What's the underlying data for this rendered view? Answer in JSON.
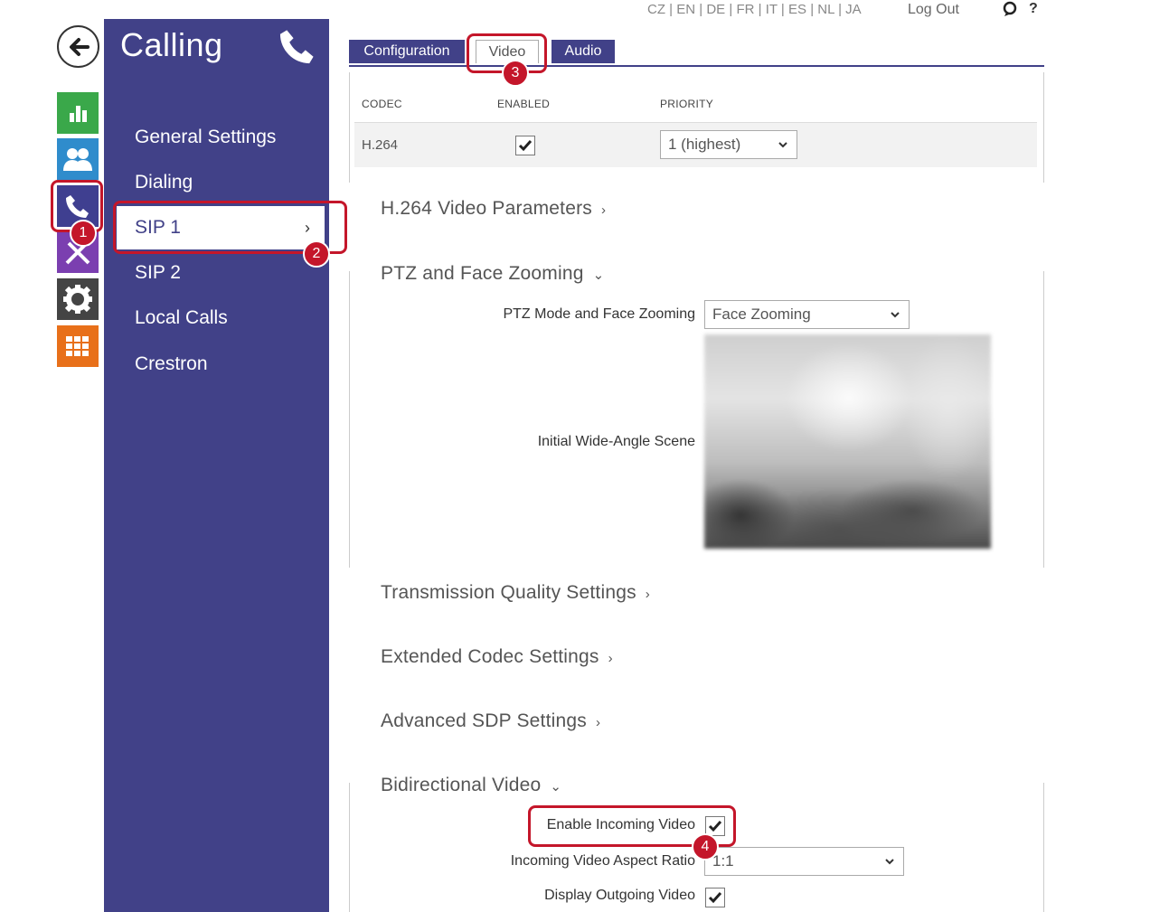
{
  "rail": {
    "back": "back-arrow-icon",
    "items": [
      "status-icon",
      "directory-icon",
      "calling-icon",
      "services-icon",
      "hardware-icon",
      "system-icon"
    ]
  },
  "sidebar": {
    "title": "Calling",
    "items": [
      {
        "label": "General Settings"
      },
      {
        "label": "Dialing"
      },
      {
        "label": "SIP 1",
        "chevron": "›"
      },
      {
        "label": "SIP 2"
      },
      {
        "label": "Local Calls"
      },
      {
        "label": "Crestron"
      }
    ]
  },
  "topbar": {
    "languages": [
      "CZ",
      "EN",
      "DE",
      "FR",
      "IT",
      "ES",
      "NL",
      "JA"
    ],
    "separator": "|",
    "logout": "Log Out",
    "help": "?"
  },
  "tabs": [
    {
      "label": "Configuration"
    },
    {
      "label": "Video",
      "active": true
    },
    {
      "label": "Audio"
    }
  ],
  "codec_table": {
    "headers": [
      "CODEC",
      "ENABLED",
      "PRIORITY"
    ],
    "rows": [
      {
        "codec": "H.264",
        "enabled": true,
        "priority": "1 (highest)"
      }
    ]
  },
  "sections": {
    "h264": {
      "title": "H.264 Video Parameters",
      "chevron": "›"
    },
    "ptz": {
      "title": "PTZ and Face Zooming",
      "chevron": "⌄",
      "mode_label": "PTZ Mode and Face Zooming",
      "mode_value": "Face Zooming",
      "scene_label": "Initial Wide-Angle Scene"
    },
    "transmission": {
      "title": "Transmission Quality Settings",
      "chevron": "›"
    },
    "extended": {
      "title": "Extended Codec Settings",
      "chevron": "›"
    },
    "sdp": {
      "title": "Advanced SDP Settings",
      "chevron": "›"
    },
    "bidirectional": {
      "title": "Bidirectional Video",
      "chevron": "⌄",
      "incoming_label": "Enable Incoming Video",
      "incoming_checked": true,
      "ratio_label": "Incoming Video Aspect Ratio",
      "ratio_value": "1:1",
      "outgoing_label": "Display Outgoing Video",
      "outgoing_checked": true
    }
  },
  "annotations": [
    "1",
    "2",
    "3",
    "4"
  ],
  "colors": {
    "sidebar": "#414188",
    "highlight": "#c4162a",
    "status": "#3aa84a",
    "directory": "#2f8ccc",
    "services": "#7b3fb0",
    "system": "#e8701a"
  }
}
